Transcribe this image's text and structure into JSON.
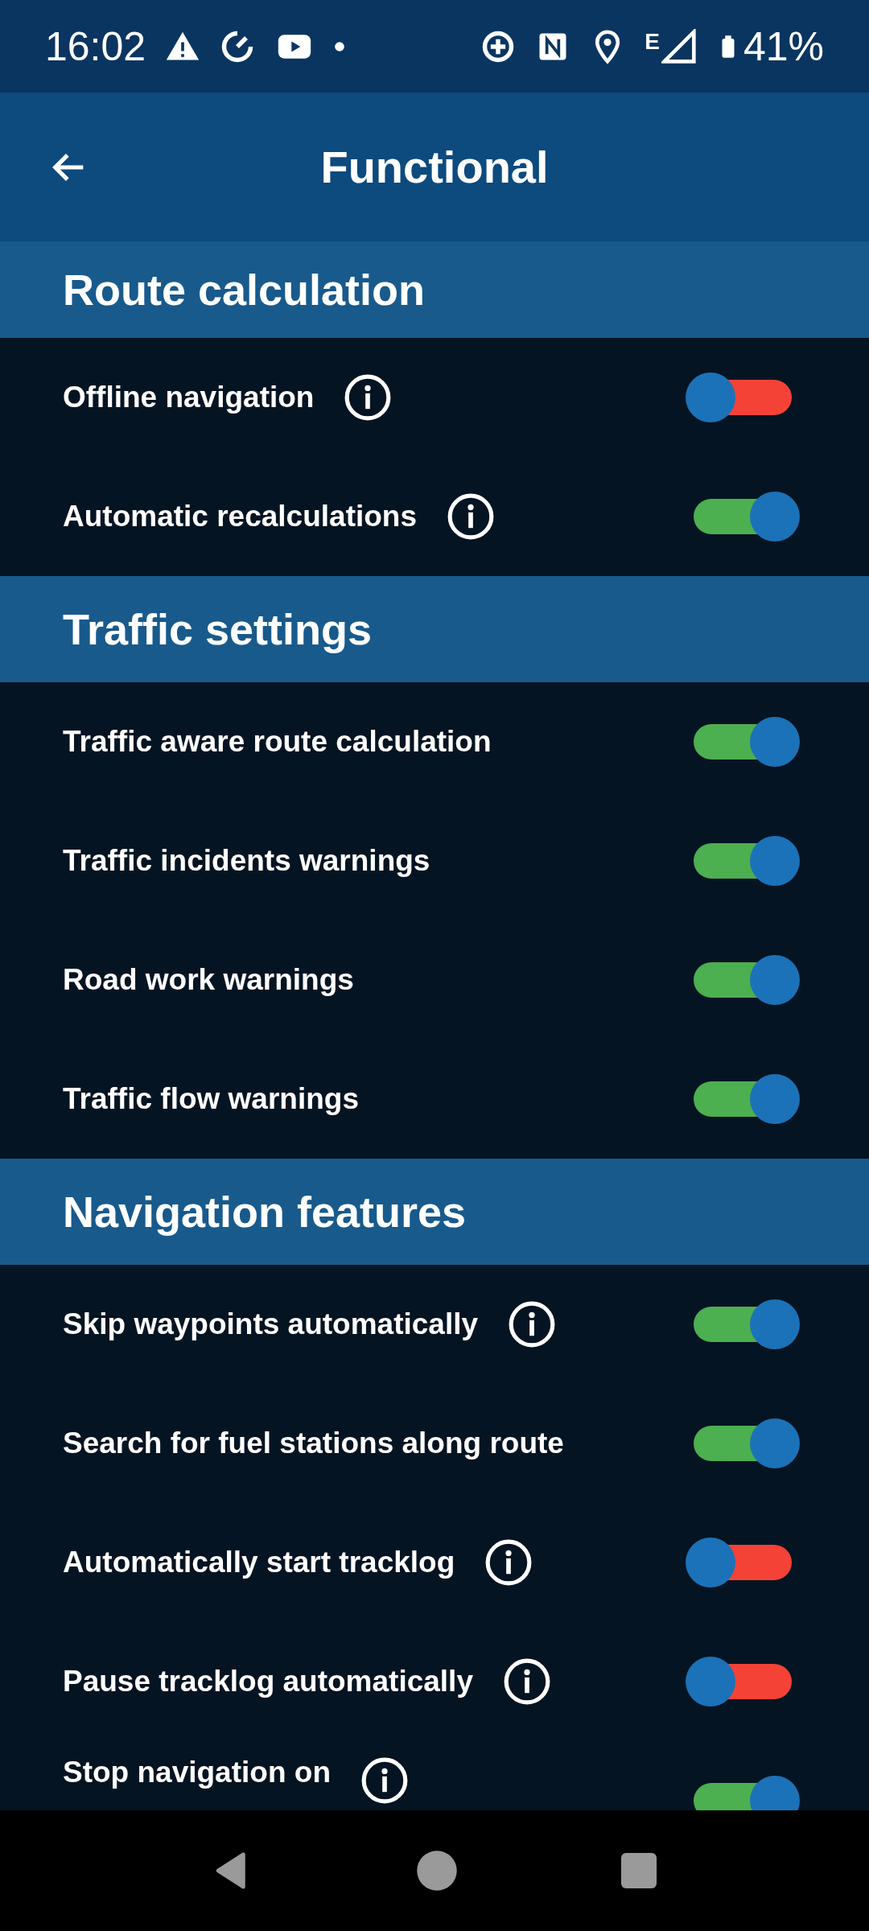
{
  "status_bar": {
    "time": "16:02",
    "network_type": "E",
    "battery": "41%"
  },
  "app_bar": {
    "title": "Functional"
  },
  "sections": [
    {
      "title": "Route calculation",
      "items": [
        {
          "label": "Offline navigation",
          "info": true,
          "on": false
        },
        {
          "label": "Automatic recalculations",
          "info": true,
          "on": true
        }
      ]
    },
    {
      "title": "Traffic settings",
      "items": [
        {
          "label": "Traffic aware route calculation",
          "info": false,
          "on": true
        },
        {
          "label": "Traffic incidents warnings",
          "info": false,
          "on": true
        },
        {
          "label": "Road work warnings",
          "info": false,
          "on": true
        },
        {
          "label": "Traffic flow warnings",
          "info": false,
          "on": true
        }
      ]
    },
    {
      "title": "Navigation features",
      "items": [
        {
          "label": "Skip waypoints automatically",
          "info": true,
          "on": true
        },
        {
          "label": "Search for fuel stations along route",
          "info": false,
          "on": true
        },
        {
          "label": "Automatically start tracklog",
          "info": true,
          "on": false
        },
        {
          "label": "Pause tracklog automatically",
          "info": true,
          "on": false
        },
        {
          "label": "Stop navigation on",
          "info": true,
          "on": true
        }
      ]
    }
  ]
}
